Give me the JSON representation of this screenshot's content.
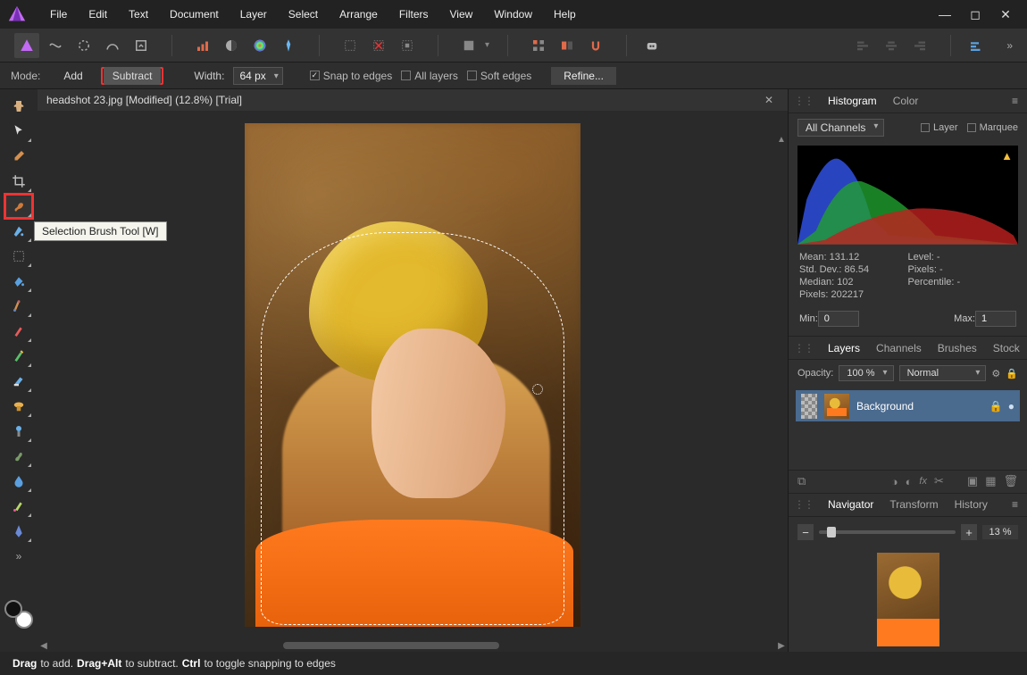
{
  "menu": [
    "File",
    "Edit",
    "Text",
    "Document",
    "Layer",
    "Select",
    "Arrange",
    "Filters",
    "View",
    "Window",
    "Help"
  ],
  "context": {
    "mode_label": "Mode:",
    "add": "Add",
    "subtract": "Subtract",
    "width_label": "Width:",
    "width_value": "64 px",
    "snap": "Snap to edges",
    "all_layers": "All layers",
    "soft_edges": "Soft edges",
    "refine": "Refine..."
  },
  "document_tab": "headshot 23.jpg [Modified] (12.8%) [Trial]",
  "tooltip": "Selection Brush Tool [W]",
  "panels": {
    "hist_tabs": {
      "histogram": "Histogram",
      "color": "Color"
    },
    "channels": "All Channels",
    "layer_chk": "Layer",
    "marquee_chk": "Marquee",
    "stats": {
      "mean": "Mean: 131.12",
      "stddev": "Std. Dev.: 86.54",
      "median": "Median: 102",
      "pixels": "Pixels: 202217",
      "level": "Level: -",
      "pixels2": "Pixels: -",
      "percentile": "Percentile: -"
    },
    "min_label": "Min:",
    "min_val": "0",
    "max_label": "Max:",
    "max_val": "1",
    "layer_tabs": {
      "layers": "Layers",
      "channels": "Channels",
      "brushes": "Brushes",
      "stock": "Stock"
    },
    "opacity_label": "Opacity:",
    "opacity_val": "100 %",
    "blend": "Normal",
    "layer_name": "Background",
    "nav_tabs": {
      "navigator": "Navigator",
      "transform": "Transform",
      "history": "History"
    },
    "zoom_pct": "13 %"
  },
  "status": {
    "p1": "Drag",
    "t1": " to add. ",
    "p2": "Drag+Alt",
    "t2": " to subtract. ",
    "p3": "Ctrl",
    "t3": " to toggle snapping to edges"
  }
}
